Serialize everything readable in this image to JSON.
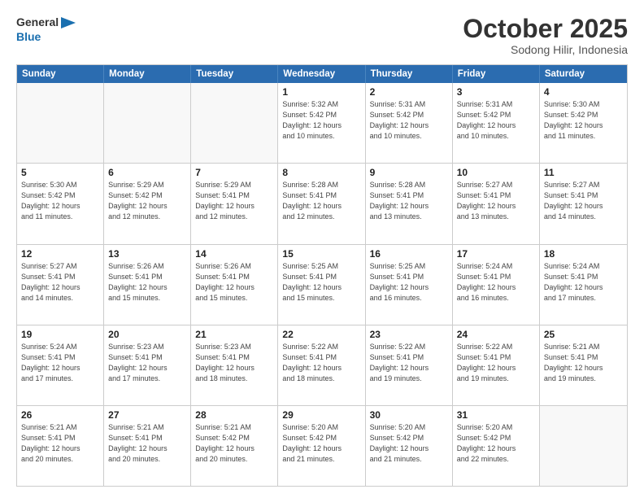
{
  "header": {
    "logo_line1": "General",
    "logo_line2": "Blue",
    "month_title": "October 2025",
    "location": "Sodong Hilir, Indonesia"
  },
  "weekdays": [
    "Sunday",
    "Monday",
    "Tuesday",
    "Wednesday",
    "Thursday",
    "Friday",
    "Saturday"
  ],
  "rows": [
    [
      {
        "day": "",
        "info": ""
      },
      {
        "day": "",
        "info": ""
      },
      {
        "day": "",
        "info": ""
      },
      {
        "day": "1",
        "info": "Sunrise: 5:32 AM\nSunset: 5:42 PM\nDaylight: 12 hours\nand 10 minutes."
      },
      {
        "day": "2",
        "info": "Sunrise: 5:31 AM\nSunset: 5:42 PM\nDaylight: 12 hours\nand 10 minutes."
      },
      {
        "day": "3",
        "info": "Sunrise: 5:31 AM\nSunset: 5:42 PM\nDaylight: 12 hours\nand 10 minutes."
      },
      {
        "day": "4",
        "info": "Sunrise: 5:30 AM\nSunset: 5:42 PM\nDaylight: 12 hours\nand 11 minutes."
      }
    ],
    [
      {
        "day": "5",
        "info": "Sunrise: 5:30 AM\nSunset: 5:42 PM\nDaylight: 12 hours\nand 11 minutes."
      },
      {
        "day": "6",
        "info": "Sunrise: 5:29 AM\nSunset: 5:42 PM\nDaylight: 12 hours\nand 12 minutes."
      },
      {
        "day": "7",
        "info": "Sunrise: 5:29 AM\nSunset: 5:41 PM\nDaylight: 12 hours\nand 12 minutes."
      },
      {
        "day": "8",
        "info": "Sunrise: 5:28 AM\nSunset: 5:41 PM\nDaylight: 12 hours\nand 12 minutes."
      },
      {
        "day": "9",
        "info": "Sunrise: 5:28 AM\nSunset: 5:41 PM\nDaylight: 12 hours\nand 13 minutes."
      },
      {
        "day": "10",
        "info": "Sunrise: 5:27 AM\nSunset: 5:41 PM\nDaylight: 12 hours\nand 13 minutes."
      },
      {
        "day": "11",
        "info": "Sunrise: 5:27 AM\nSunset: 5:41 PM\nDaylight: 12 hours\nand 14 minutes."
      }
    ],
    [
      {
        "day": "12",
        "info": "Sunrise: 5:27 AM\nSunset: 5:41 PM\nDaylight: 12 hours\nand 14 minutes."
      },
      {
        "day": "13",
        "info": "Sunrise: 5:26 AM\nSunset: 5:41 PM\nDaylight: 12 hours\nand 15 minutes."
      },
      {
        "day": "14",
        "info": "Sunrise: 5:26 AM\nSunset: 5:41 PM\nDaylight: 12 hours\nand 15 minutes."
      },
      {
        "day": "15",
        "info": "Sunrise: 5:25 AM\nSunset: 5:41 PM\nDaylight: 12 hours\nand 15 minutes."
      },
      {
        "day": "16",
        "info": "Sunrise: 5:25 AM\nSunset: 5:41 PM\nDaylight: 12 hours\nand 16 minutes."
      },
      {
        "day": "17",
        "info": "Sunrise: 5:24 AM\nSunset: 5:41 PM\nDaylight: 12 hours\nand 16 minutes."
      },
      {
        "day": "18",
        "info": "Sunrise: 5:24 AM\nSunset: 5:41 PM\nDaylight: 12 hours\nand 17 minutes."
      }
    ],
    [
      {
        "day": "19",
        "info": "Sunrise: 5:24 AM\nSunset: 5:41 PM\nDaylight: 12 hours\nand 17 minutes."
      },
      {
        "day": "20",
        "info": "Sunrise: 5:23 AM\nSunset: 5:41 PM\nDaylight: 12 hours\nand 17 minutes."
      },
      {
        "day": "21",
        "info": "Sunrise: 5:23 AM\nSunset: 5:41 PM\nDaylight: 12 hours\nand 18 minutes."
      },
      {
        "day": "22",
        "info": "Sunrise: 5:22 AM\nSunset: 5:41 PM\nDaylight: 12 hours\nand 18 minutes."
      },
      {
        "day": "23",
        "info": "Sunrise: 5:22 AM\nSunset: 5:41 PM\nDaylight: 12 hours\nand 19 minutes."
      },
      {
        "day": "24",
        "info": "Sunrise: 5:22 AM\nSunset: 5:41 PM\nDaylight: 12 hours\nand 19 minutes."
      },
      {
        "day": "25",
        "info": "Sunrise: 5:21 AM\nSunset: 5:41 PM\nDaylight: 12 hours\nand 19 minutes."
      }
    ],
    [
      {
        "day": "26",
        "info": "Sunrise: 5:21 AM\nSunset: 5:41 PM\nDaylight: 12 hours\nand 20 minutes."
      },
      {
        "day": "27",
        "info": "Sunrise: 5:21 AM\nSunset: 5:41 PM\nDaylight: 12 hours\nand 20 minutes."
      },
      {
        "day": "28",
        "info": "Sunrise: 5:21 AM\nSunset: 5:42 PM\nDaylight: 12 hours\nand 20 minutes."
      },
      {
        "day": "29",
        "info": "Sunrise: 5:20 AM\nSunset: 5:42 PM\nDaylight: 12 hours\nand 21 minutes."
      },
      {
        "day": "30",
        "info": "Sunrise: 5:20 AM\nSunset: 5:42 PM\nDaylight: 12 hours\nand 21 minutes."
      },
      {
        "day": "31",
        "info": "Sunrise: 5:20 AM\nSunset: 5:42 PM\nDaylight: 12 hours\nand 22 minutes."
      },
      {
        "day": "",
        "info": ""
      }
    ]
  ]
}
